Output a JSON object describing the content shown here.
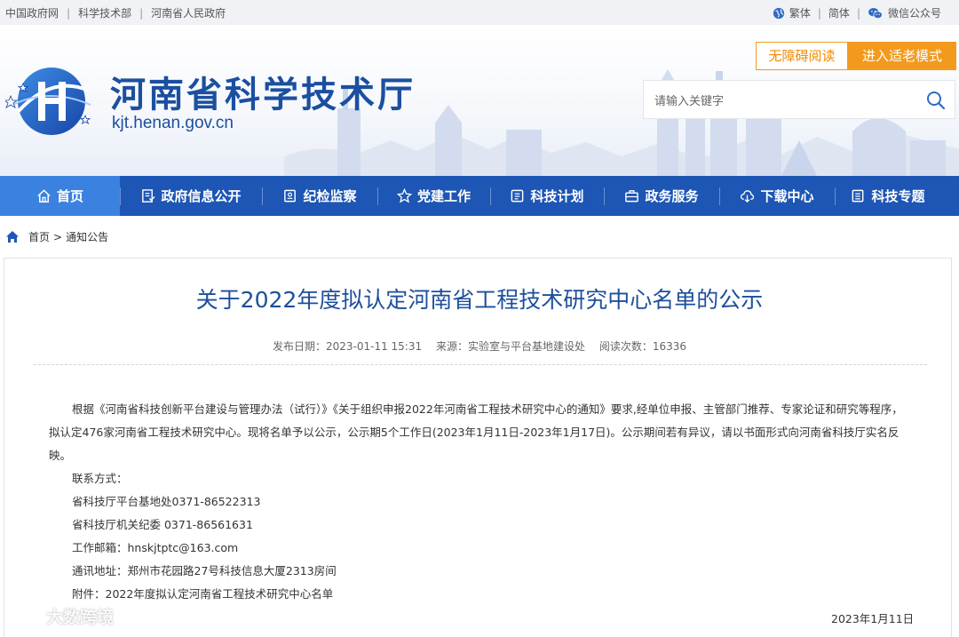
{
  "topbar": {
    "links": [
      "中国政府网",
      "科学技术部",
      "河南省人民政府"
    ],
    "traditional": "繁体",
    "simplified": "简体",
    "wechat": "微信公众号"
  },
  "header": {
    "title": "河南省科学技术厅",
    "domain": "kjt.henan.gov.cn",
    "accessibility_btn": "无障碍阅读",
    "elder_mode_btn": "进入适老模式",
    "search_placeholder": "请输入关键字"
  },
  "nav": {
    "items": [
      {
        "label": "首页",
        "icon": "home-icon"
      },
      {
        "label": "政府信息公开",
        "icon": "document-icon"
      },
      {
        "label": "纪检监察",
        "icon": "inspection-icon"
      },
      {
        "label": "党建工作",
        "icon": "star-icon"
      },
      {
        "label": "科技计划",
        "icon": "plan-icon"
      },
      {
        "label": "政务服务",
        "icon": "briefcase-icon"
      },
      {
        "label": "下载中心",
        "icon": "cloud-download-icon"
      },
      {
        "label": "科技专题",
        "icon": "topic-icon"
      }
    ]
  },
  "breadcrumb": {
    "home": "首页",
    "separator": ">",
    "current": "通知公告"
  },
  "article": {
    "title": "关于2022年度拟认定河南省工程技术研究中心名单的公示",
    "publish_label": "发布日期：",
    "publish_date": "2023-01-11 15:31",
    "source_label": "来源：",
    "source": "实验室与平台基地建设处",
    "views_label": "阅读次数：",
    "views": "16336",
    "paragraph": "根据《河南省科技创新平台建设与管理办法（试行）》《关于组织申报2022年河南省工程技术研究中心的通知》要求,经单位申报、主管部门推荐、专家论证和研究等程序，拟认定476家河南省工程技术研究中心。现将名单予以公示，公示期5个工作日(2023年1月11日-2023年1月17日)。公示期间若有异议，请以书面形式向河南省科技厅实名反映。",
    "contact_label": "联系方式：",
    "contact_platform": "省科技厅平台基地处0371-86522313",
    "contact_discipline": "省科技厅机关纪委 0371-86561631",
    "email": "工作邮箱：hnskjtptc@163.com",
    "address": "通讯地址：郑州市花园路27号科技信息大厦2313房间",
    "attachment": "附件：2022年度拟认定河南省工程技术研究中心名单",
    "date": "2023年1月11日"
  },
  "watermark": "大数跨境",
  "colors": {
    "brand_blue": "#1d56b4",
    "nav_active": "#3b82e0",
    "title_blue": "#1d4f9c",
    "accent_orange": "#f39a1e"
  }
}
